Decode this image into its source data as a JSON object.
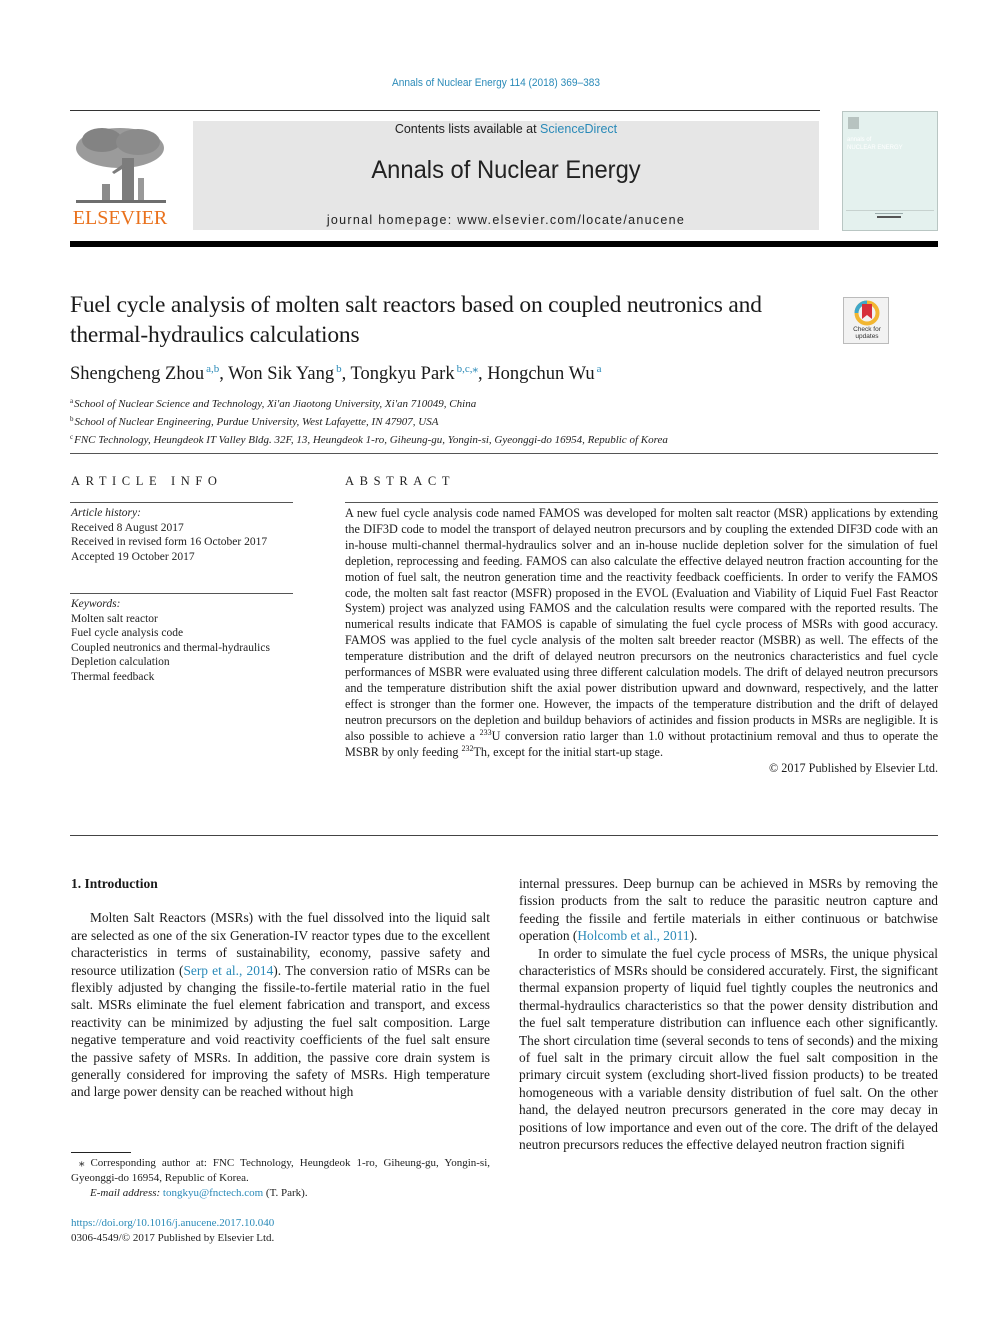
{
  "header": {
    "journal_reference": "Annals of Nuclear Energy 114 (2018) 369–383",
    "contents_prefix": "Contents lists available at ",
    "contents_link": "ScienceDirect",
    "journal_title": "Annals of Nuclear Energy",
    "homepage_prefix": "journal homepage: ",
    "homepage_url": "www.elsevier.com/locate/anucene",
    "publisher_wordmark": "ELSEVIER",
    "cover_title_line1": "annals of",
    "cover_title_line2": "NUCLEAR ENERGY",
    "check_updates_line1": "Check for",
    "check_updates_line2": "updates"
  },
  "article": {
    "title": "Fuel cycle analysis of molten salt reactors based on coupled neutronics and thermal-hydraulics calculations",
    "authors": [
      {
        "name": "Shengcheng Zhou",
        "affil": "a,b"
      },
      {
        "name": "Won Sik Yang",
        "affil": "b"
      },
      {
        "name": "Tongkyu Park",
        "affil": "b,c,⁎"
      },
      {
        "name": "Hongchun Wu",
        "affil": "a"
      }
    ],
    "affiliations": [
      {
        "key": "a",
        "text": "School of Nuclear Science and Technology, Xi'an Jiaotong University, Xi'an 710049, China"
      },
      {
        "key": "b",
        "text": "School of Nuclear Engineering, Purdue University, West Lafayette, IN 47907, USA"
      },
      {
        "key": "c",
        "text": "FNC Technology, Heungdeok IT Valley Bldg. 32F, 13, Heungdeok 1-ro, Giheung-gu, Yongin-si, Gyeonggi-do 16954, Republic of Korea"
      }
    ]
  },
  "article_info": {
    "heading": "ARTICLE INFO",
    "history_label": "Article history:",
    "history": [
      "Received 8 August 2017",
      "Received in revised form 16 October 2017",
      "Accepted 19 October 2017"
    ],
    "keywords_label": "Keywords:",
    "keywords": [
      "Molten salt reactor",
      "Fuel cycle analysis code",
      "Coupled neutronics and thermal-hydraulics",
      "Depletion calculation",
      "Thermal feedback"
    ]
  },
  "abstract": {
    "heading": "ABSTRACT",
    "text_part1": "A new fuel cycle analysis code named FAMOS was developed for molten salt reactor (MSR) applications by extending the DIF3D code to model the transport of delayed neutron precursors and by coupling the extended DIF3D code with an in-house multi-channel thermal-hydraulics solver and an in-house nuclide depletion solver for the simulation of fuel depletion, reprocessing and feeding. FAMOS can also calculate the effective delayed neutron fraction accounting for the motion of fuel salt, the neutron generation time and the reactivity feedback coefficients. In order to verify the FAMOS code, the molten salt fast reactor (MSFR) proposed in the EVOL (Evaluation and Viability of Liquid Fuel Fast Reactor System) project was analyzed using FAMOS and the calculation results were compared with the reported results. The numer­ical results indicate that FAMOS is capable of simulating the fuel cycle process of MSRs with good accu­racy. FAMOS was applied to the fuel cycle analysis of the molten salt breeder reactor (MSBR) as well. The effects of the temperature distribution and the drift of delayed neutron precursors on the neutronics characteristics and fuel cycle performances of MSBR were evaluated using three different calculation models. The drift of delayed neutron precursors and the temperature distribution shift the axial power distribution upward and downward, respectively, and the latter effect is stronger than the former one. However, the impacts of the temperature distribution and the drift of delayed neutron precursors on the depletion and buildup behaviors of actinides and fission products in MSRs are negligible. It is also possible to achieve a ",
    "sup1": "233",
    "text_part2": "U conversion ratio larger than 1.0 without protactinium removal and thus to operate the MSBR by only feeding ",
    "sup2": "232",
    "text_part3": "Th, except for the initial start-up stage.",
    "copyright": "© 2017 Published by Elsevier Ltd."
  },
  "body": {
    "section_heading": "1. Introduction",
    "left_p1_a": "Molten Salt Reactors (MSRs) with the fuel dissolved into the liq­uid salt are selected as one of the six Generation-IV reactor types due to the excellent characteristics in terms of sustainability, econ­omy, passive safety and resource utilization (",
    "left_p1_cite": "Serp et al., 2014",
    "left_p1_b": "). The conversion ratio of MSRs can be flexibly adjusted by changing the fissile-to-fertile material ratio in the fuel salt. MSRs eliminate the fuel element fabrication and transport, and excess reactivity can be minimized by adjusting the fuel salt composition. Large negative temperature and void reactivity coefficients of the fuel salt ensure the passive safety of MSRs. In addition, the passive core drain sys­tem is generally considered for improving the safety of MSRs. High temperature and large power density can be reached without high",
    "right_p1_a": "internal pressures. Deep burnup can be achieved in MSRs by remov­ing the fission products from the salt to reduce the parasitic neutron capture and feeding the fissile and fertile materials in either contin­uous or batchwise operation (",
    "right_p1_cite": "Holcomb et al., 2011",
    "right_p1_b": ").",
    "right_p2": "In order to simulate the fuel cycle process of MSRs, the unique physical characteristics of MSRs should be considered accurately. First, the significant thermal expansion property of liquid fuel tightly couples the neutronics and thermal-hydraulics characteris­tics so that the power density distribution and the fuel salt temper­ature distribution can influence each other significantly. The short circulation time (several seconds to tens of seconds) and the mix­ing of fuel salt in the primary circuit allow the fuel salt composition in the primary circuit system (excluding short-lived fission prod­ucts) to be treated homogeneous with a variable density distribu­tion of fuel salt. On the other hand, the delayed neutron precursors generated in the core may decay in positions of low importance and even out of the core. The drift of the delayed neutron precursors reduces the effective delayed neutron fraction signifi­"
  },
  "footnote": {
    "star": "⁎",
    "corresponding": " Corresponding author at: FNC Technology, Heungdeok 1-ro, Giheung-gu, Yongin-si, Gyeonggi-do 16954, Republic of Korea.",
    "email_label": "E-mail address: ",
    "email": "tongkyu@fnctech.com",
    "email_suffix": " (T. Park).",
    "doi": "https://doi.org/10.1016/j.anucene.2017.10.040",
    "issn_line": "0306-4549/© 2017 Published by Elsevier Ltd."
  },
  "colors": {
    "link": "#2a8ab8",
    "elsevier_orange": "#e9711c",
    "header_band": "#e6e6e6",
    "cover": "#e4f1ee"
  }
}
